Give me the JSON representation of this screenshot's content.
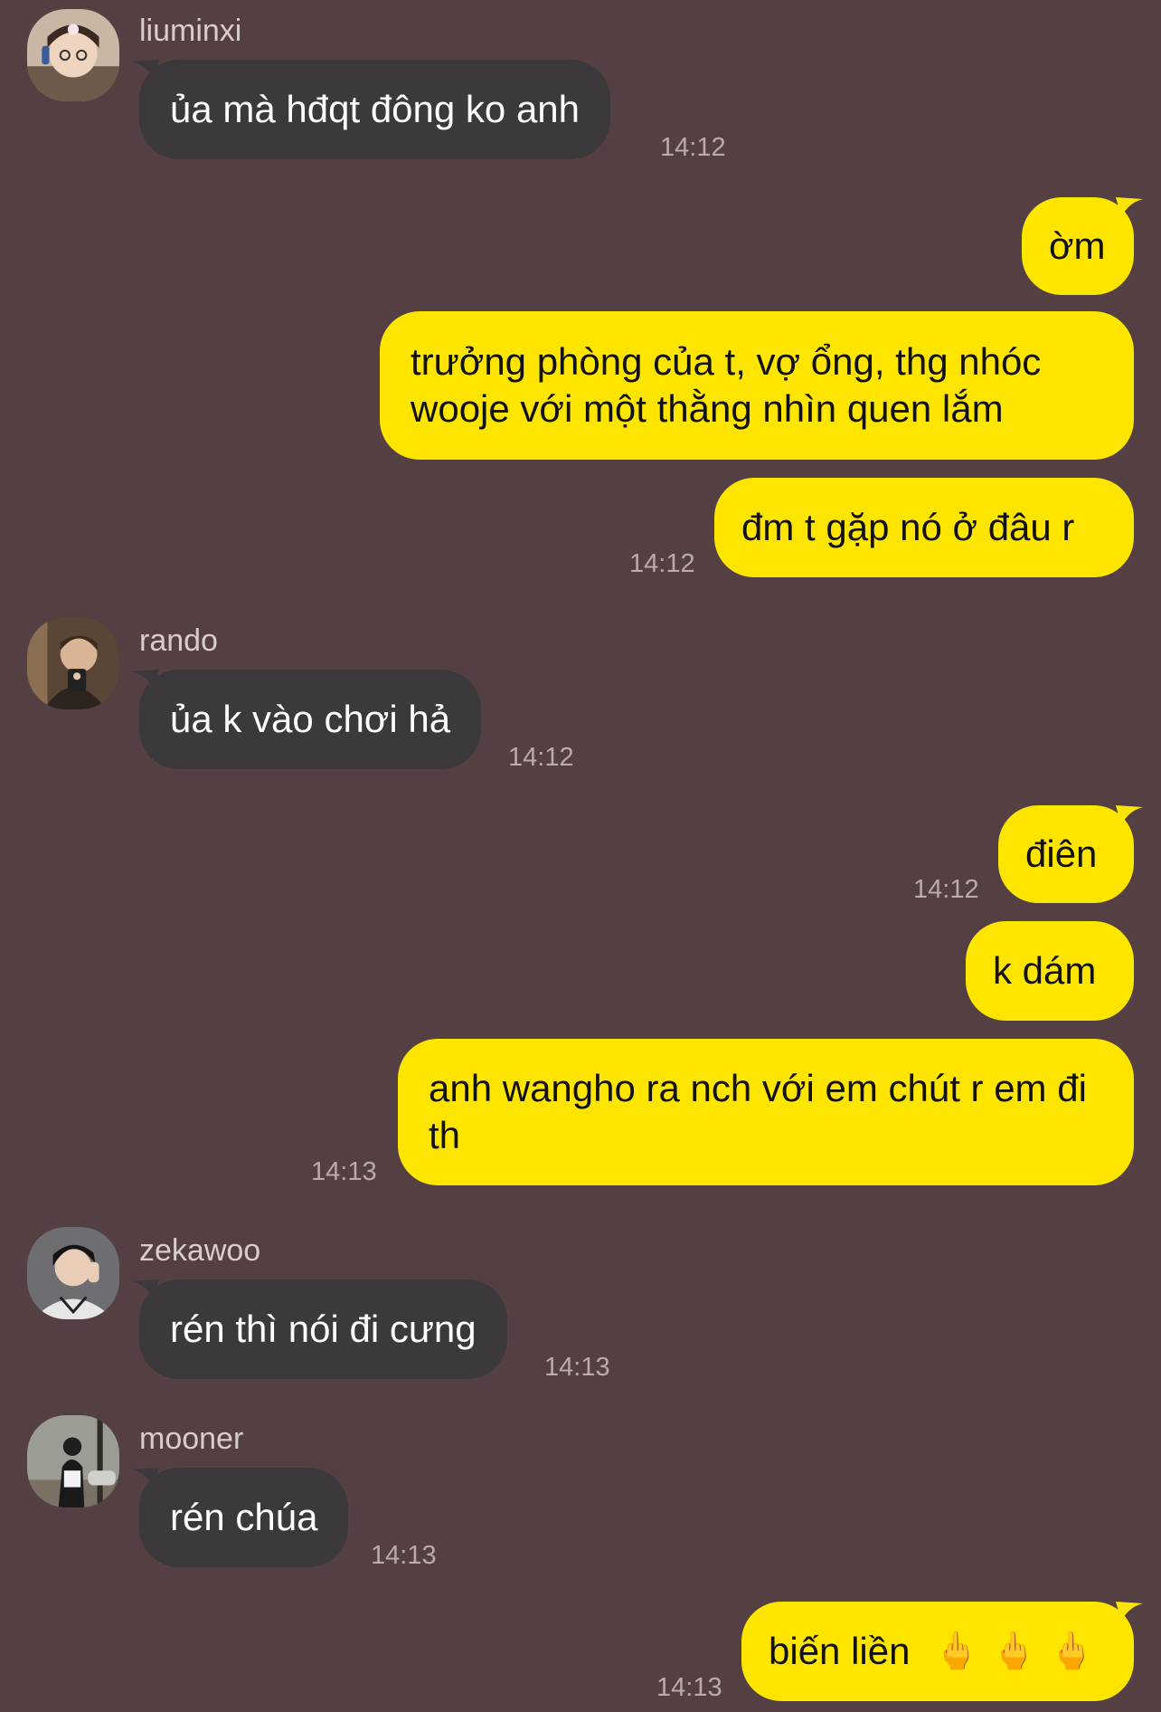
{
  "messages": [
    {
      "sender": "liuminxi",
      "text": "ủa mà hđqt đông ko anh",
      "time": "14:12"
    },
    {
      "text": "ờm"
    },
    {
      "text": "trưởng phòng của t, vợ ổng, thg nhóc wooje với một thằng nhìn quen lắm"
    },
    {
      "text": "đm t gặp nó ở đâu r",
      "time": "14:12"
    },
    {
      "sender": "rando",
      "text": "ủa k vào chơi hả",
      "time": "14:12"
    },
    {
      "text": "điên",
      "time": "14:12"
    },
    {
      "text": "k dám"
    },
    {
      "text": "anh wangho ra nch với em chút r em đi th",
      "time": "14:13"
    },
    {
      "sender": "zekawoo",
      "text": "rén thì nói đi cưng",
      "time": "14:13"
    },
    {
      "sender": "mooner",
      "text": "rén chúa",
      "time": "14:13"
    },
    {
      "text": "biến liền",
      "emoji": "🖕",
      "time": "14:13"
    }
  ],
  "colors": {
    "background": "#544042",
    "incoming_bubble": "#3b393b",
    "outgoing_bubble": "#fee500"
  },
  "icons": [
    "avatar-liuminxi-icon",
    "avatar-rando-icon",
    "avatar-zekawoo-icon",
    "avatar-mooner-icon",
    "middle-finger-emoji"
  ]
}
